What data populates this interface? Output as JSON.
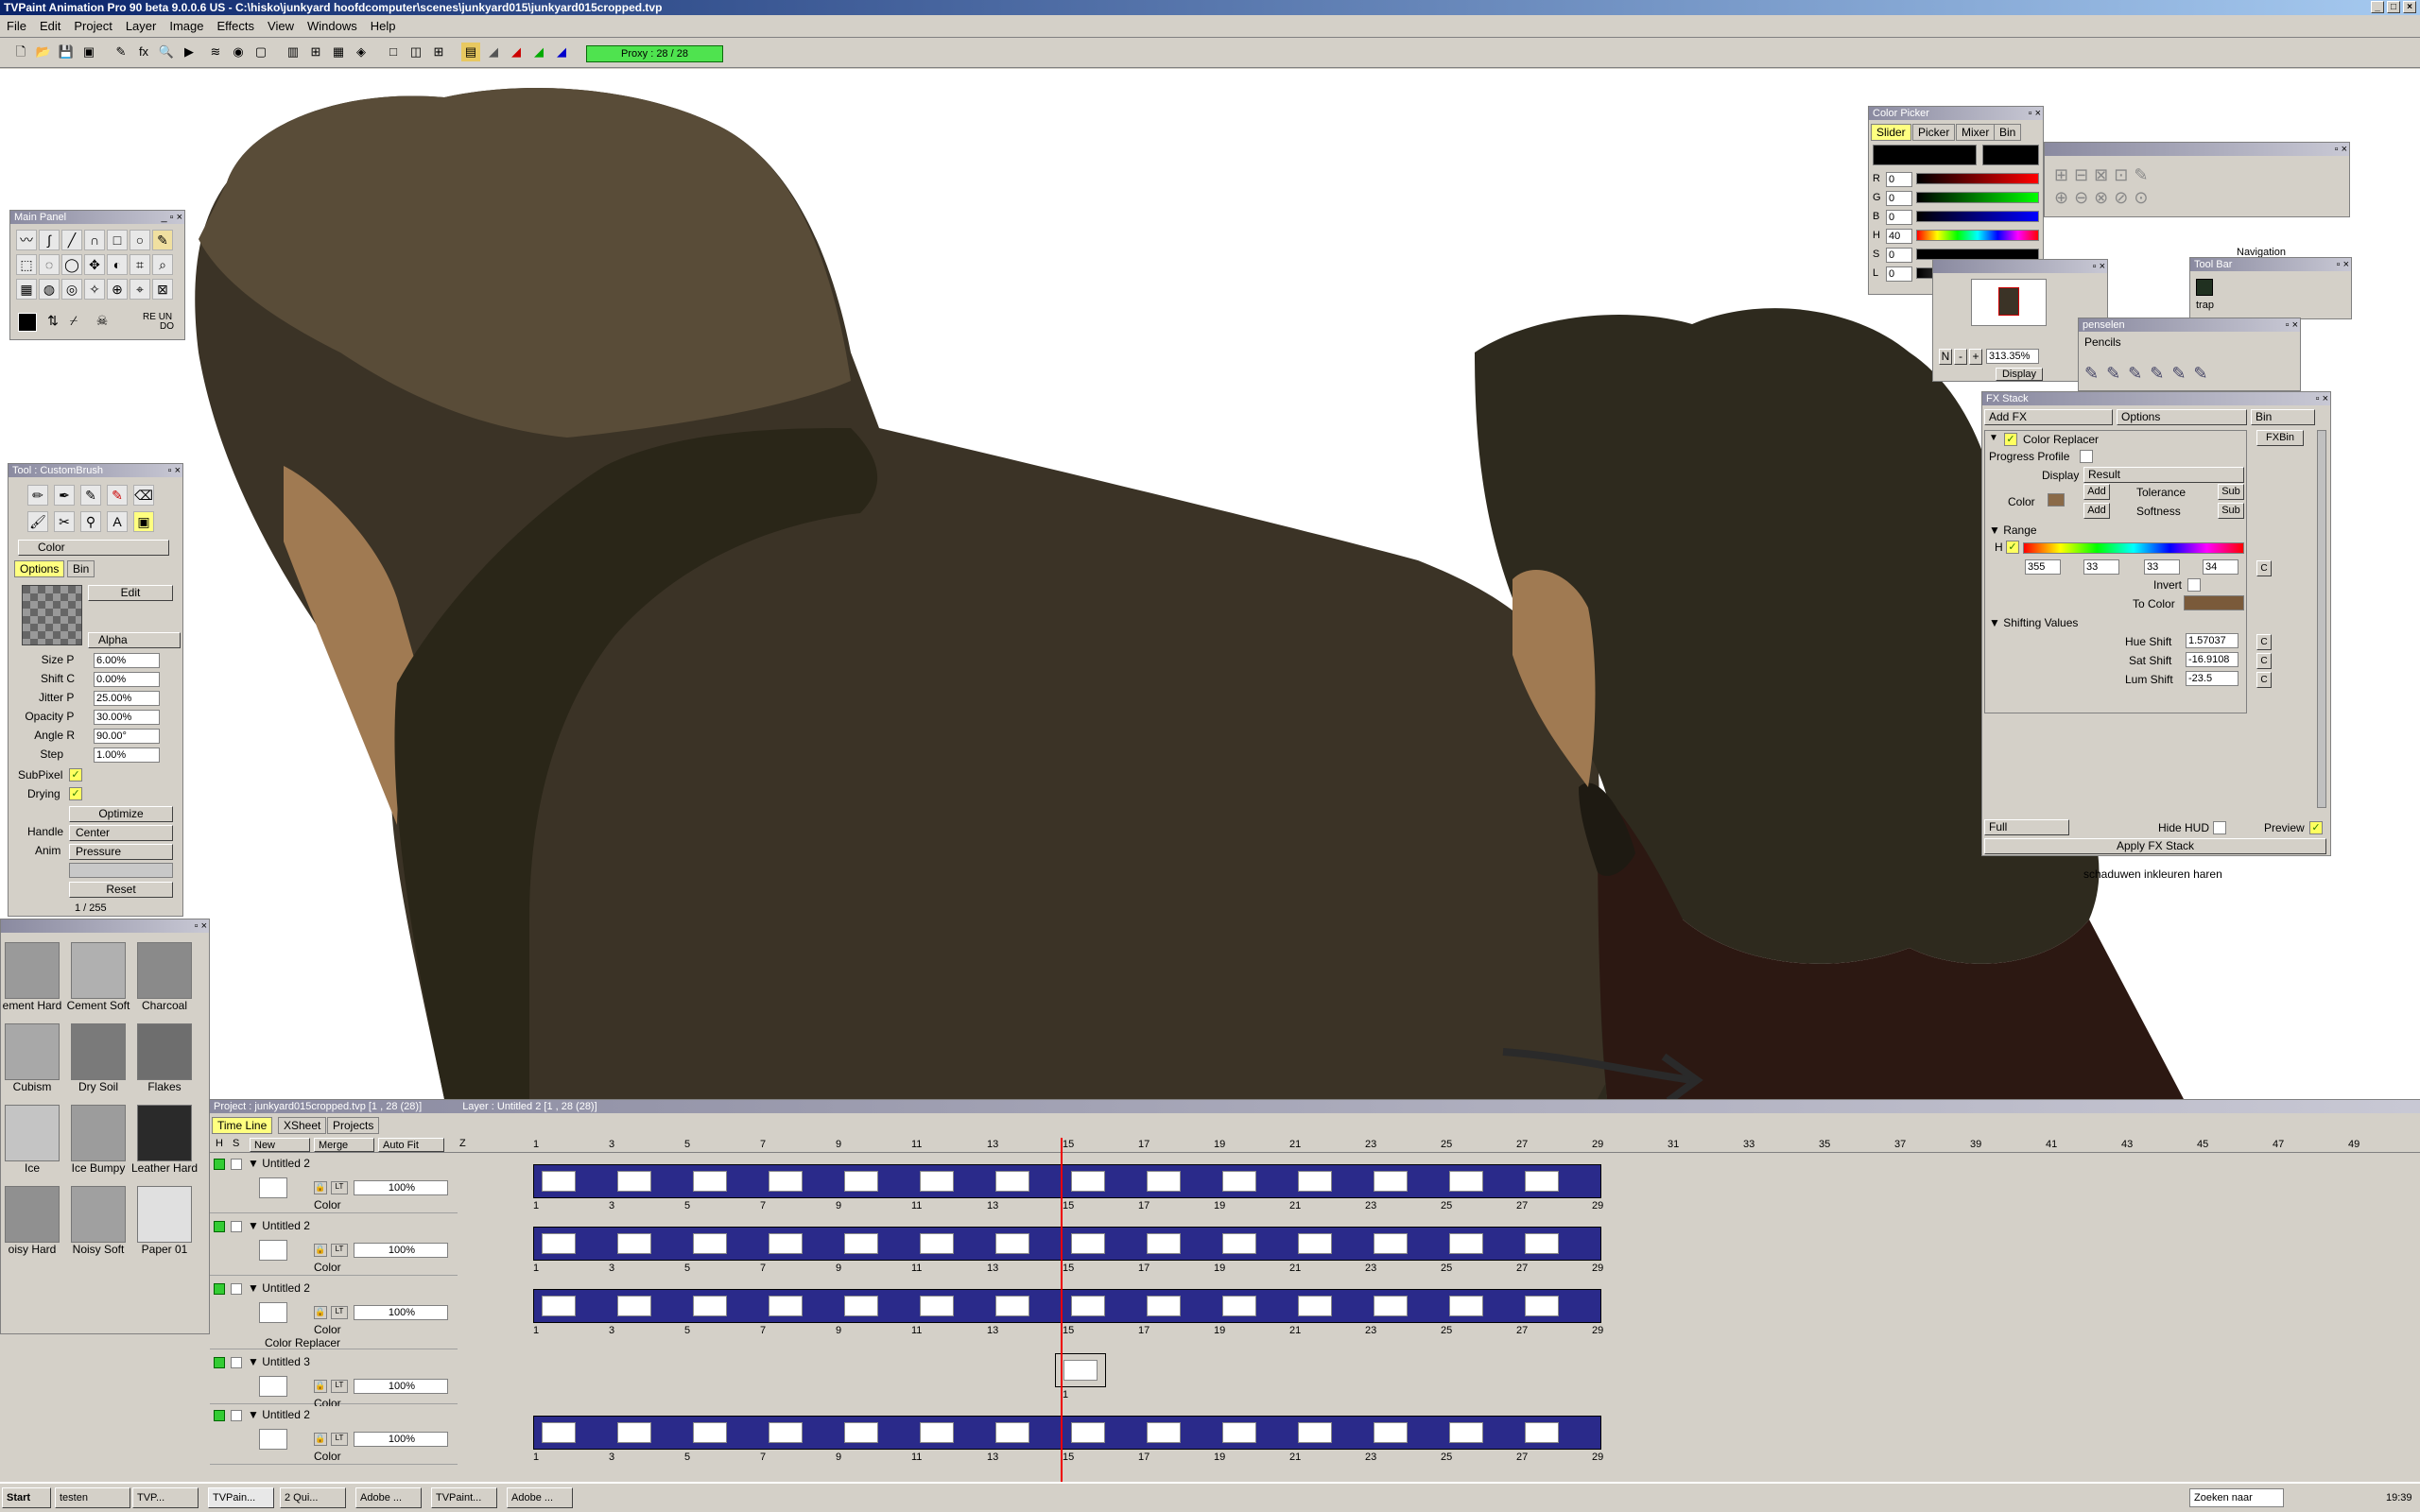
{
  "window": {
    "title": "TVPaint Animation Pro 90 beta 9.0.0.6 US - C:\\hisko\\junkyard hoofdcomputer\\scenes\\junkyard015\\junkyard015cropped.tvp"
  },
  "menu": [
    "File",
    "Edit",
    "Project",
    "Layer",
    "Image",
    "Effects",
    "View",
    "Windows",
    "Help"
  ],
  "toolbar": {
    "proxy": "Proxy : 28 / 28"
  },
  "main_panel": {
    "title": "Main Panel",
    "labels": [
      "RE",
      "UN",
      "DO"
    ]
  },
  "tool_panel": {
    "title": "Tool : CustomBrush",
    "mode": "Color",
    "tabs": [
      "Options",
      "Bin"
    ],
    "edit": "Edit",
    "blend": "Alpha",
    "params": [
      {
        "label": "Size",
        "prefix": "P",
        "value": "6.00%"
      },
      {
        "label": "Shift",
        "prefix": "C",
        "value": "0.00%"
      },
      {
        "label": "Jitter",
        "prefix": "P",
        "value": "25.00%"
      },
      {
        "label": "Opacity",
        "prefix": "P",
        "value": "30.00%"
      },
      {
        "label": "Angle",
        "prefix": "R",
        "value": "90.00°"
      },
      {
        "label": "Step",
        "prefix": "",
        "value": "1.00%"
      }
    ],
    "subpixel": "SubPixel",
    "drying": "Drying",
    "optimize": "Optimize",
    "handle_label": "Handle",
    "handle": "Center",
    "anim_label": "Anim",
    "anim": "Pressure",
    "reset": "Reset",
    "counter": "1 / 255"
  },
  "textures": [
    {
      "name": "ement Hard",
      "color": "#9a9a9a"
    },
    {
      "name": "Cement Soft",
      "color": "#b0b0b0"
    },
    {
      "name": "Charcoal",
      "color": "#8a8a8a"
    },
    {
      "name": "Cubism",
      "color": "#a8a8a8"
    },
    {
      "name": "Dry Soil",
      "color": "#7a7a7a"
    },
    {
      "name": "Flakes",
      "color": "#6e6e6e"
    },
    {
      "name": "Ice",
      "color": "#c4c4c4"
    },
    {
      "name": "Ice Bumpy",
      "color": "#9c9c9c"
    },
    {
      "name": "Leather Hard",
      "color": "#2a2a2a"
    },
    {
      "name": "oisy Hard",
      "color": "#909090"
    },
    {
      "name": "Noisy Soft",
      "color": "#a0a0a0"
    },
    {
      "name": "Paper 01",
      "color": "#e0e0e0"
    }
  ],
  "color_picker": {
    "title": "Color Picker",
    "tabs": [
      "Slider",
      "Picker",
      "Mixer",
      "Bin"
    ],
    "channels": [
      {
        "label": "R",
        "value": "0"
      },
      {
        "label": "G",
        "value": "0"
      },
      {
        "label": "B",
        "value": "0"
      },
      {
        "label": "H",
        "value": "40"
      },
      {
        "label": "S",
        "value": "0"
      },
      {
        "label": "L",
        "value": "0"
      }
    ]
  },
  "navigation": {
    "title": "Navigation",
    "zoom": "313.35%",
    "display": "Display"
  },
  "toolbar_panel": {
    "title": "Tool Bar",
    "label": "trap"
  },
  "penselen": {
    "title": "penselen",
    "group": "Pencils"
  },
  "fx_stack": {
    "title": "FX Stack",
    "add_fx": "Add FX",
    "options": "Options",
    "bin": "Bin",
    "fxbin": "FXBin",
    "effect": "Color Replacer",
    "progress": "Progress Profile",
    "display_label": "Display",
    "display": "Result",
    "color_label": "Color",
    "add": "Add",
    "tolerance": "Tolerance",
    "softness": "Softness",
    "sub": "Sub",
    "range": "Range",
    "h": "H",
    "range_values": [
      "355",
      "33",
      "33",
      "34"
    ],
    "invert": "Invert",
    "to_color": "To Color",
    "shifting": "Shifting Values",
    "hue_shift_label": "Hue Shift",
    "hue_shift": "1.57037",
    "sat_shift_label": "Sat Shift",
    "sat_shift": "-16.9108",
    "lum_shift_label": "Lum Shift",
    "lum_shift": "-23.5",
    "c": "C",
    "full": "Full",
    "hide_hud": "Hide HUD",
    "preview": "Preview",
    "apply": "Apply FX Stack",
    "footer": "schaduwen inkleuren haren"
  },
  "timeline": {
    "project_info": "Project : junkyard015cropped.tvp [1 , 28  (28)]",
    "layer_info": "Layer : Untitled 2 [1 , 28  (28)]",
    "tabs": [
      "Time Line",
      "XSheet",
      "Projects"
    ],
    "cols": [
      "H",
      "S",
      "New",
      "Merge",
      "Auto Fit",
      "Z"
    ],
    "ruler": [
      "1",
      "3",
      "5",
      "7",
      "9",
      "11",
      "13",
      "15",
      "17",
      "19",
      "21",
      "23",
      "25",
      "27",
      "29",
      "31",
      "33",
      "35",
      "37",
      "39",
      "41",
      "43",
      "45",
      "47",
      "49"
    ],
    "layers": [
      {
        "name": "Untitled 2",
        "opacity": "100%",
        "mode": "Color",
        "extra": ""
      },
      {
        "name": "Untitled 2",
        "opacity": "100%",
        "mode": "Color",
        "extra": ""
      },
      {
        "name": "Untitled 2",
        "opacity": "100%",
        "mode": "Color",
        "extra": "Color Replacer"
      },
      {
        "name": "Untitled 3",
        "opacity": "100%",
        "mode": "Color",
        "extra": ""
      },
      {
        "name": "Untitled 2",
        "opacity": "100%",
        "mode": "Color",
        "extra": ""
      }
    ],
    "frame_numbers": [
      "1",
      "3",
      "5",
      "7",
      "9",
      "11",
      "13",
      "15",
      "17",
      "19",
      "21",
      "23",
      "25",
      "27",
      "29"
    ],
    "single_frame": "1"
  },
  "taskbar": {
    "start": "Start",
    "tasks": [
      "testen",
      "TVP...",
      "TVPain...",
      "2 Qui...",
      "Adobe ...",
      "TVPaint...",
      "Adobe ..."
    ],
    "search": "Zoeken naar",
    "clock": "19:39"
  },
  "colors": {
    "fx_to_color": "#7a5a3a",
    "fx_color": "#8a6a48",
    "proxy": "#4fe34f"
  }
}
